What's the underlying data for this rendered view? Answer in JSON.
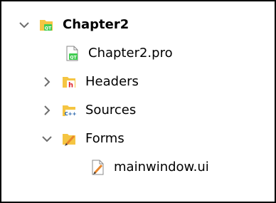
{
  "tree": {
    "project": {
      "label": "Chapter2",
      "expanded": true,
      "icon": "qt-project-folder-icon"
    },
    "pro_file": {
      "label": "Chapter2.pro",
      "icon": "qt-pro-file-icon"
    },
    "headers": {
      "label": "Headers",
      "expanded": false,
      "icon": "headers-folder-icon"
    },
    "sources": {
      "label": "Sources",
      "expanded": false,
      "icon": "sources-folder-icon"
    },
    "forms": {
      "label": "Forms",
      "expanded": true,
      "icon": "forms-folder-icon"
    },
    "ui_file": {
      "label": "mainwindow.ui",
      "icon": "ui-file-icon"
    }
  },
  "colors": {
    "folder": "#F5C542",
    "qt_green": "#41CD52",
    "header_red": "#E0242B",
    "pencil_orange": "#E8862C",
    "chevron": "#6E6E6E"
  }
}
